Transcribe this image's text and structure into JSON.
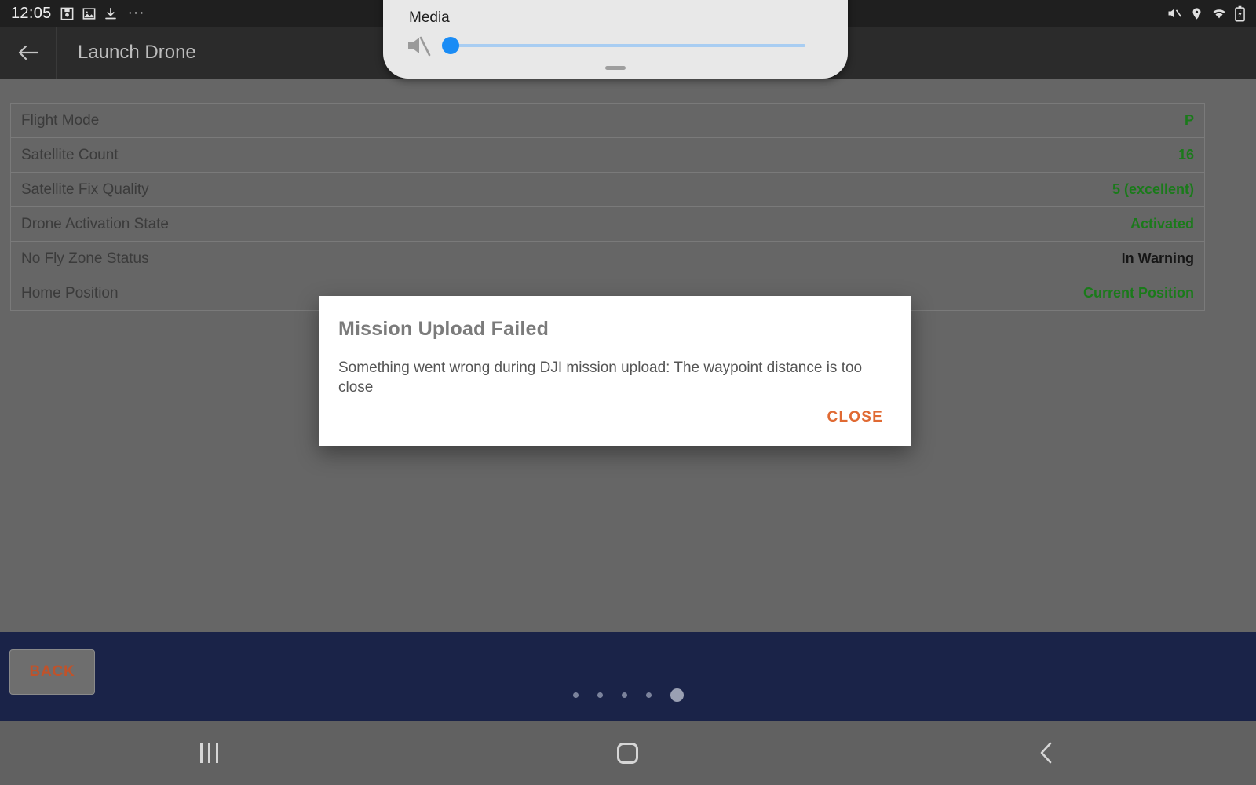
{
  "status_bar": {
    "time": "12:05",
    "left_icons": [
      "screenshot-icon",
      "image-icon",
      "download-icon"
    ],
    "overflow": "···",
    "right_icons": [
      "mute-icon",
      "location-icon",
      "wifi-icon",
      "battery-charging-icon"
    ]
  },
  "app_bar": {
    "back_icon": "arrow-left-icon",
    "title": "Launch Drone"
  },
  "media_panel": {
    "label": "Media",
    "volume_icon": "volume-muted-icon",
    "volume_value": 0,
    "volume_min": 0,
    "volume_max": 100,
    "handle": "drag-handle"
  },
  "table": {
    "rows": [
      {
        "label": "Flight Mode",
        "value": "P",
        "value_color": "#1a7a1a"
      },
      {
        "label": "Satellite Count",
        "value": "16",
        "value_color": "#1a7a1a"
      },
      {
        "label": "Satellite Fix Quality",
        "value": "5 (excellent)",
        "value_color": "#1a7a1a"
      },
      {
        "label": "Drone Activation State",
        "value": "Activated",
        "value_color": "#1a7a1a"
      },
      {
        "label": "No Fly Zone Status",
        "value": "In Warning",
        "value_color": "#161616"
      },
      {
        "label": "Home Position",
        "value": "Current Position",
        "value_color": "#1a7a1a"
      }
    ]
  },
  "dialog": {
    "title": "Mission Upload Failed",
    "message": "Something went wrong during DJI mission upload: The waypoint distance is too close",
    "close_label": "CLOSE",
    "close_color": "#e06a33"
  },
  "footer": {
    "back_label": "BACK",
    "page_dots_total": 5,
    "page_dots_active_index": 4,
    "background_color": "#1a2348"
  },
  "nav_bar": {
    "recents": "recents-icon",
    "home": "home-icon",
    "back": "back-icon"
  }
}
